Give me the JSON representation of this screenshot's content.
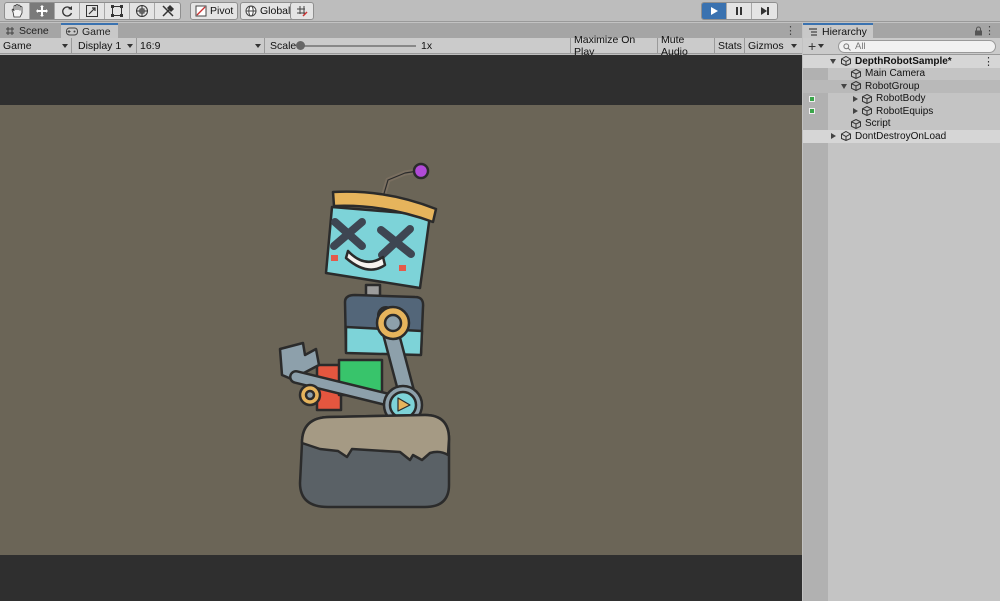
{
  "toolbar": {
    "tools": [
      {
        "icon": "hand-tool-icon",
        "active": false
      },
      {
        "icon": "move-tool-icon",
        "active": true
      },
      {
        "icon": "rotate-tool-icon",
        "active": false
      },
      {
        "icon": "scale-tool-icon",
        "active": false
      },
      {
        "icon": "rect-tool-icon",
        "active": false
      },
      {
        "icon": "transform-tool-icon",
        "active": false
      },
      {
        "icon": "custom-tool-icon",
        "active": false
      }
    ],
    "pivot_label": "Pivot",
    "global_label": "Global",
    "colors": {
      "play_active": "#3a72b0"
    }
  },
  "game_panel": {
    "tabs": [
      {
        "label": "Scene",
        "active": false
      },
      {
        "label": "Game",
        "active": true
      }
    ],
    "display_mode": "Game",
    "display": "Display 1",
    "aspect": "16:9",
    "scale_label": "Scale",
    "scale_value": "1x",
    "scale_slider_fraction": 0.0,
    "toggles": [
      "Maximize On Play",
      "Mute Audio",
      "Stats",
      "Gizmos"
    ],
    "colors": {
      "background": "#6b6557",
      "letterbox": "#2f2f2f"
    }
  },
  "hierarchy": {
    "title": "Hierarchy",
    "search_placeholder": "All",
    "items": [
      {
        "label": "DepthRobotSample*",
        "type": "scene",
        "expanded": true
      },
      {
        "label": "Main Camera",
        "type": "object"
      },
      {
        "label": "RobotGroup",
        "type": "object",
        "expanded": true
      },
      {
        "label": "RobotBody",
        "type": "object",
        "expanded": false
      },
      {
        "label": "RobotEquips",
        "type": "object",
        "expanded": false
      },
      {
        "label": "Script",
        "type": "object"
      },
      {
        "label": "DontDestroyOnLoad",
        "type": "scene",
        "expanded": false
      }
    ]
  }
}
